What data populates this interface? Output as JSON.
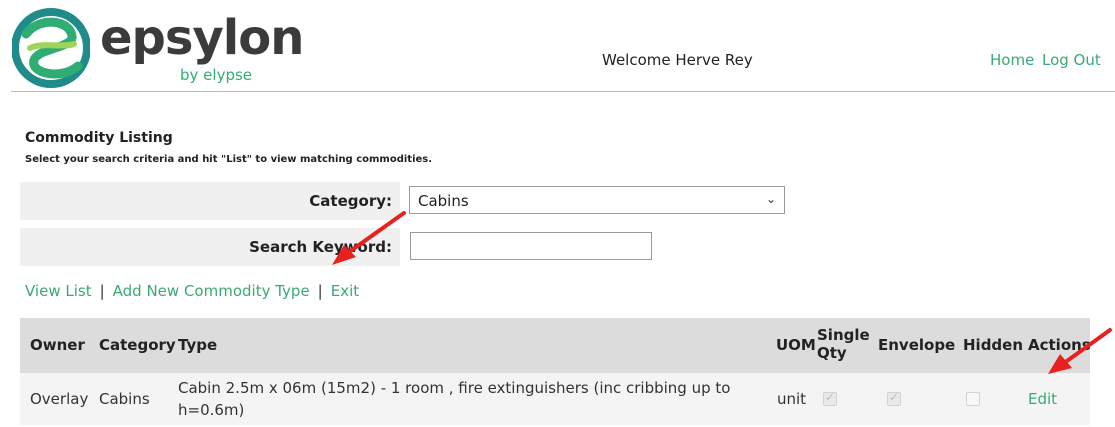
{
  "brand": {
    "name": "epsylon",
    "tagline": "by elypse",
    "colors": {
      "green": "#2fae73",
      "teal": "#1f8c8a",
      "dark": "#3b3b3b"
    }
  },
  "header": {
    "welcome": "Welcome Herve Rey",
    "nav": {
      "home": "Home",
      "logout": "Log Out"
    }
  },
  "page": {
    "title": "Commodity Listing",
    "subtitle": "Select your search criteria and hit \"List\" to view matching commodities."
  },
  "criteria": {
    "category_label": "Category:",
    "category_value": "Cabins",
    "keyword_label": "Search Keyword:",
    "keyword_value": ""
  },
  "actions": {
    "view_list": "View List",
    "add_new": "Add New Commodity Type",
    "exit": "Exit",
    "separator": "|"
  },
  "table": {
    "headers": {
      "owner": "Owner",
      "category": "Category",
      "type": "Type",
      "uom": "UOM",
      "single_qty_1": "Single",
      "single_qty_2": "Qty",
      "envelope": "Envelope",
      "hidden": "Hidden",
      "actions": "Actions"
    },
    "rows": [
      {
        "owner": "Overlay",
        "category": "Cabins",
        "type_line1": "Cabin 2.5m x 06m (15m2) - 1 room , fire extinguishers (inc cribbing up to",
        "type_line2": "h=0.6m)",
        "uom": "unit",
        "single_qty": true,
        "envelope": true,
        "hidden": false,
        "action": "Edit"
      }
    ]
  },
  "annotation_color": "#e8211f"
}
